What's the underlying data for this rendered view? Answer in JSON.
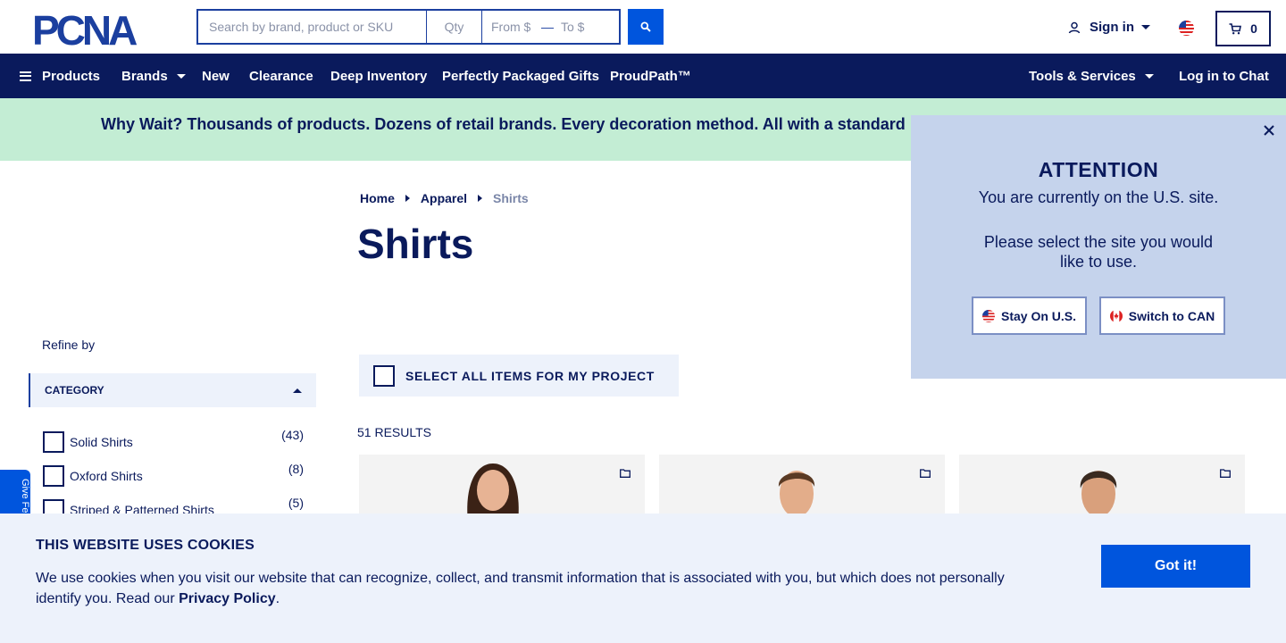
{
  "header": {
    "logo_text": "PCNA",
    "search": {
      "placeholder": "Search by brand, product or SKU",
      "qty_placeholder": "Qty",
      "from_placeholder": "From $",
      "to_placeholder": "To $",
      "search_icon": "search-icon"
    },
    "signin_label": "Sign in",
    "cart_count": "0"
  },
  "nav": {
    "products": "Products",
    "brands": "Brands",
    "new": "New",
    "clearance": "Clearance",
    "deep_inventory": "Deep Inventory",
    "gifts": "Perfectly Packaged Gifts",
    "proudpath": "ProudPath™",
    "tools": "Tools & Services",
    "chat": "Log in to Chat"
  },
  "promo": {
    "text": "Why Wait? Thousands of products. Dozens of retail brands. Every decoration method. All with a standard"
  },
  "breadcrumb": {
    "home": "Home",
    "apparel": "Apparel",
    "current": "Shirts"
  },
  "page_title": "Shirts",
  "sidebar": {
    "refine_label": "Refine by",
    "category_label": "CATEGORY",
    "items": [
      {
        "label": "Solid Shirts",
        "count": "(43)"
      },
      {
        "label": "Oxford Shirts",
        "count": "(8)"
      },
      {
        "label": "Striped & Patterned Shirts",
        "count": "(5)"
      }
    ]
  },
  "listing": {
    "select_all_label": "SELECT ALL ITEMS FOR MY PROJECT",
    "results_label": "51 RESULTS"
  },
  "feedback_label": "Give Fe",
  "attention": {
    "title": "ATTENTION",
    "line1": "You are currently on the U.S. site.",
    "line2": "Please select the site you would like to use.",
    "stay_label": "Stay On U.S.",
    "switch_label": "Switch to CAN"
  },
  "cookie": {
    "title": "THIS WEBSITE USES COOKIES",
    "text": "We use cookies when you visit our website that can recognize, collect, and transmit information that is associated with you, but which does not personally identify you. Read our ",
    "link": "Privacy Policy",
    "end": ".",
    "button": "Got it!"
  },
  "colors": {
    "navy": "#0a1a5c",
    "accent_blue": "#0055dd",
    "promo_green": "#c3edd4",
    "popup_blue": "#c5d3ec",
    "light_panel": "#edf2fb"
  }
}
